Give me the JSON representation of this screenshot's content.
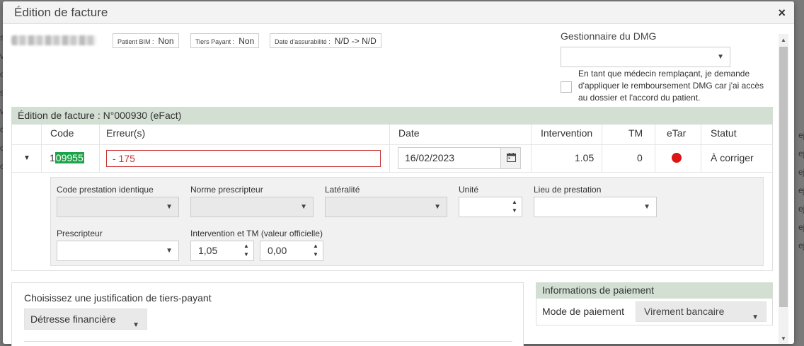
{
  "dialog": {
    "title": "Édition de facture",
    "close_label": "×"
  },
  "patient": {
    "chips": [
      {
        "label": "Patient BIM :",
        "value": "Non"
      },
      {
        "label": "Tiers Payant :",
        "value": "Non"
      },
      {
        "label": "Date d'assurabilité :",
        "value": "N/D -> N/D"
      }
    ]
  },
  "dmg": {
    "label": "Gestionnaire du DMG",
    "selected": "",
    "replacement_text": "En tant que médecin remplaçant, je demande d'appliquer le remboursement DMG car j'ai accès au dossier et l'accord du patient.",
    "replacement_checked": false
  },
  "invoice": {
    "section_title": "Édition de facture : N°000930 (eFact)",
    "columns": [
      "Code",
      "Erreur(s)",
      "Date",
      "Intervention",
      "TM",
      "eTar",
      "Statut"
    ],
    "rows": [
      {
        "code_prefix": "1",
        "code_highlight": "09955",
        "errors": "- 175",
        "date": "16/02/2023",
        "intervention": "1.05",
        "tm": "0",
        "etar_status_color": "#dc1414",
        "statut": "À corriger"
      }
    ]
  },
  "details": {
    "code_prestation_identique": {
      "label": "Code prestation identique",
      "value": ""
    },
    "norme_prescripteur": {
      "label": "Norme prescripteur",
      "value": ""
    },
    "lateralite": {
      "label": "Latéralité",
      "value": ""
    },
    "unite": {
      "label": "Unité",
      "value": ""
    },
    "lieu_prestation": {
      "label": "Lieu de prestation",
      "value": ""
    },
    "prescripteur": {
      "label": "Prescripteur",
      "value": ""
    },
    "intervention_tm": {
      "label": "Intervention et TM (valeur officielle)",
      "intervention": "1,05",
      "tm": "0,00"
    }
  },
  "tiers_payant": {
    "label": "Choisissez une justification de tiers-payant",
    "selected": "Détresse financière"
  },
  "payment": {
    "section_title": "Informations de paiement",
    "mode_label": "Mode de paiement",
    "mode_selected": "Virement bancaire"
  },
  "colors": {
    "section_bar": "#d3dfd3",
    "error_red": "#c83232",
    "code_highlight": "#1fa34a"
  }
}
